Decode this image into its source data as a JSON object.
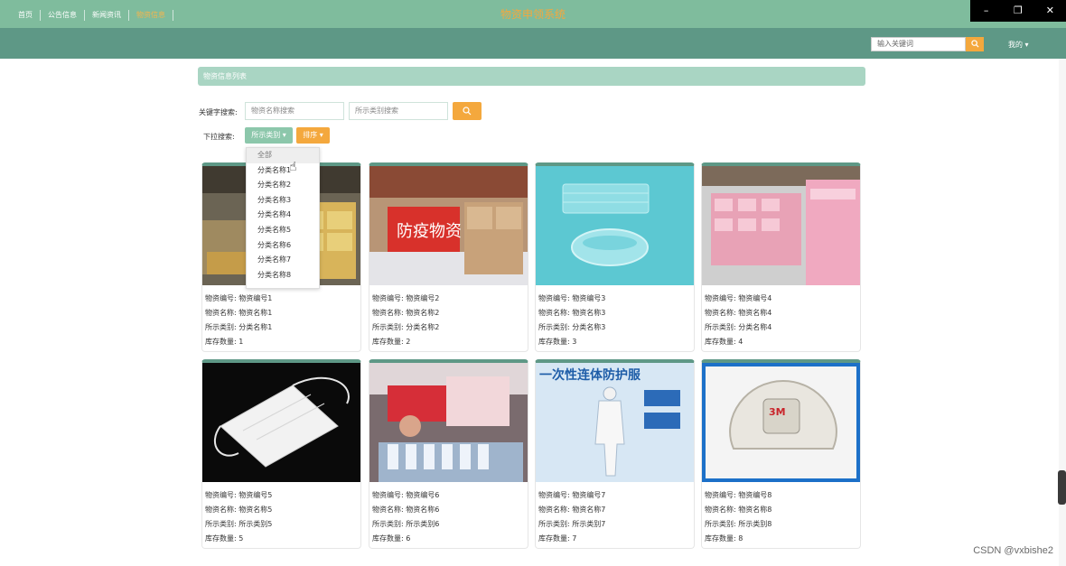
{
  "app": {
    "title": "物资申领系统"
  },
  "window_controls": [
    "–",
    "❐",
    "✕"
  ],
  "nav": {
    "items": [
      "首页",
      "公告信息",
      "新闻资讯",
      "物资信息"
    ],
    "active_index": 3,
    "search_placeholder": "输入关键词",
    "mine_label": "我的"
  },
  "section": {
    "title": "物资信息列表"
  },
  "filters": {
    "keyword_label": "关键字搜索:",
    "name_placeholder": "物资名称搜索",
    "category_placeholder": "所示类别搜索",
    "dropdown_label": "下拉搜索:",
    "category_button": "所示类别 ▾",
    "sort_button": "排序 ▾"
  },
  "dropdown_options": [
    "全部",
    "分类名称1",
    "分类名称2",
    "分类名称3",
    "分类名称4",
    "分类名称5",
    "分类名称6",
    "分类名称7",
    "分类名称8"
  ],
  "cards": [
    {
      "lines": [
        "物资编号: 物资编号1",
        "物资名称: 物资名称1",
        "所示类别: 分类名称1",
        "库存数量: 1"
      ],
      "image": "warehouse-boxes"
    },
    {
      "lines": [
        "物资编号: 物资编号2",
        "物资名称: 物资名称2",
        "所示类别: 分类名称2",
        "库存数量: 2"
      ],
      "image": "epidemic-supplies",
      "banner_text": "防疫物资"
    },
    {
      "lines": [
        "物资编号: 物资编号3",
        "物资名称: 物资名称3",
        "所示类别: 分类名称3",
        "库存数量: 3"
      ],
      "image": "blue-masks"
    },
    {
      "lines": [
        "物资编号: 物资编号4",
        "物资名称: 物资名称4",
        "所示类别: 分类名称4",
        "库存数量: 4"
      ],
      "image": "pink-boxes"
    },
    {
      "lines": [
        "物资编号: 物资编号5",
        "物资名称: 物资名称5",
        "所示类别: 所示类别5",
        "库存数量: 5"
      ],
      "image": "white-mask"
    },
    {
      "lines": [
        "物资编号: 物资编号6",
        "物资名称: 物资名称6",
        "所示类别: 所示类别6",
        "库存数量: 6"
      ],
      "image": "sanitizer-bottles"
    },
    {
      "lines": [
        "物资编号: 物资编号7",
        "物资名称: 物资名称7",
        "所示类别: 所示类别7",
        "库存数量: 7"
      ],
      "image": "protective-suit",
      "banner_text": "一次性连体防护服"
    },
    {
      "lines": [
        "物资编号: 物资编号8",
        "物资名称: 物资名称8",
        "所示类别: 所示类别8",
        "库存数量: 8"
      ],
      "image": "respirator-3m",
      "logo_text": "3M"
    }
  ],
  "watermark": "CSDN @vxbishe2",
  "colors": {
    "header": "#7fbc9d",
    "nav": "#5e9886",
    "accent": "#f4a83d",
    "section": "#a9d5c3"
  }
}
